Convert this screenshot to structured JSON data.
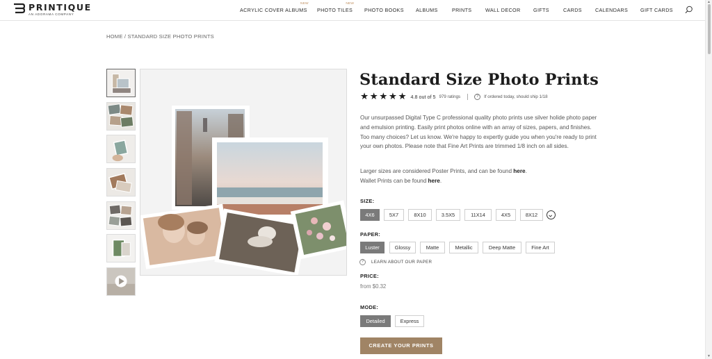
{
  "brand": {
    "name": "PRINTIQUE",
    "tagline": "AN ADORAMA COMPANY"
  },
  "nav": {
    "items": [
      {
        "label": "ACRYLIC COVER ALBUMS",
        "badge": "NEW"
      },
      {
        "label": "PHOTO TILES",
        "badge": "NEW"
      },
      {
        "label": "PHOTO BOOKS",
        "badge": ""
      },
      {
        "label": "ALBUMS",
        "badge": ""
      },
      {
        "label": "PRINTS",
        "badge": ""
      },
      {
        "label": "WALL DECOR",
        "badge": ""
      },
      {
        "label": "GIFTS",
        "badge": ""
      },
      {
        "label": "CARDS",
        "badge": ""
      },
      {
        "label": "CALENDARS",
        "badge": ""
      },
      {
        "label": "GIFT CARDS",
        "badge": ""
      }
    ],
    "search_icon": "search-icon"
  },
  "breadcrumb": {
    "home": "HOME",
    "separator": " / ",
    "current": "STANDARD SIZE PHOTO PRINTS"
  },
  "gallery": {
    "thumbnails": [
      "thumb-1",
      "thumb-2",
      "thumb-3",
      "thumb-4",
      "thumb-5",
      "thumb-6",
      "thumb-video"
    ],
    "active_index": 0
  },
  "product": {
    "title": "Standard Size Photo Prints",
    "rating": {
      "stars": 5,
      "text": "4.8 out of 5",
      "count": "979 ratings"
    },
    "shipping_note": "If ordered today, should ship 1/18",
    "description": "Our unsurpassed Digital Type C professional quality photo prints use silver holide photo paper and emulsion printing. Easily print photos online with an array of sizes, papers, and finishes. Too many choices? Let us know. We're happy to expertly guide you when you're ready to print your own photos. Please note that Fine Art Prints are trimmed 1/8 inch on all sides.",
    "poster_text": "Larger sizes are considered Poster Prints, and can be found ",
    "poster_link": "here",
    "poster_end": ".",
    "wallet_text": "Wallet Prints can be found ",
    "wallet_link": "here",
    "wallet_end": "."
  },
  "size": {
    "label": "SIZE:",
    "options": [
      "4X6",
      "5X7",
      "8X10",
      "3.5X5",
      "11X14",
      "4X5",
      "8X12"
    ],
    "selected": "4X6",
    "more_icon": "chevron-down-icon"
  },
  "paper": {
    "label": "PAPER:",
    "options": [
      "Luster",
      "Glossy",
      "Matte",
      "Metallic",
      "Deep Matte",
      "Fine Art"
    ],
    "selected": "Luster",
    "learn_link": "LEARN ABOUT OUR PAPER"
  },
  "price": {
    "label": "PRICE:",
    "value": "from $0.32"
  },
  "mode": {
    "label": "MODE:",
    "options": [
      "Detailed",
      "Express"
    ],
    "selected": "Detailed"
  },
  "cta": {
    "label": "CREATE YOUR PRINTS",
    "color": "#a08465"
  },
  "colors": {
    "selected_option": "#7a7a7a",
    "accent_new": "#c09060"
  }
}
